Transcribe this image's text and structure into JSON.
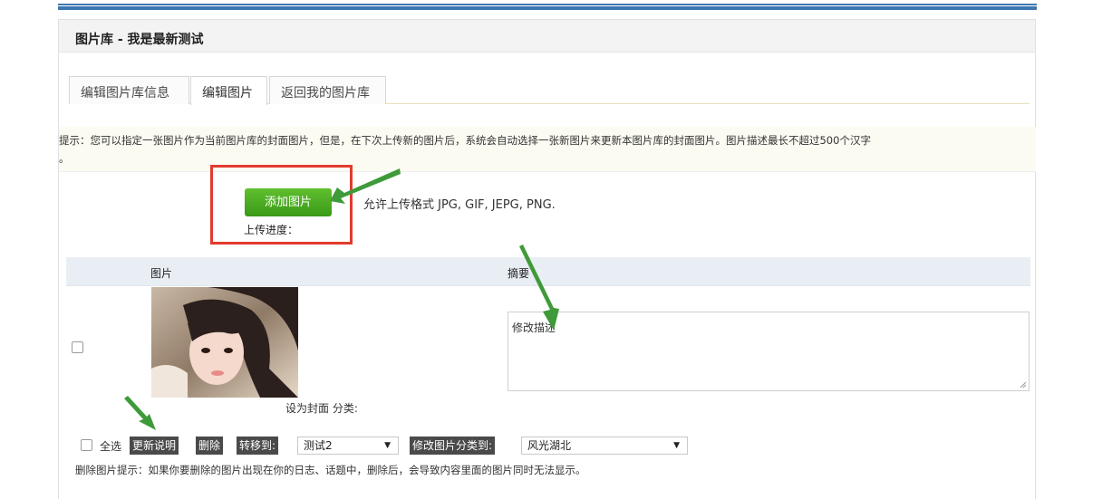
{
  "panel": {
    "title": "图片库 - 我是最新测试"
  },
  "tabs": [
    {
      "label": "编辑图片库信息"
    },
    {
      "label": "编辑图片"
    },
    {
      "label": "返回我的图片库"
    }
  ],
  "tip": {
    "line1": "提示：您可以指定一张图片作为当前图片库的封面图片，但是，在下次上传新的图片后，系统会自动选择一张新图片来更新本图片库的封面图片。图片描述最长不超过500个汉字",
    "line2": "。"
  },
  "upload": {
    "button_label": "添加图片",
    "formats": "允许上传格式 JPG, GIF, JEPG, PNG.",
    "progress_label": "上传进度："
  },
  "table": {
    "col_image": "图片",
    "col_summary": "摘要",
    "rows": [
      {
        "set_cover": "设为封面 分类:",
        "summary": "修改描述"
      }
    ]
  },
  "bulk": {
    "select_all": "全选",
    "update_desc": "更新说明",
    "delete": "删除",
    "move_to": "转移到:",
    "move_target": "测试2",
    "change_category": "修改图片分类到:",
    "category_value": "风光湖北",
    "dropdown_arrow": "▼"
  },
  "delete_tip": "删除图片提示：如果你要删除的图片出现在你的日志、话题中，删除后，会导致内容里面的图片同时无法显示。",
  "colors": {
    "accent_blue": "#3d78b1",
    "button_green": "#4aa71f",
    "highlight_red": "#e23b2e",
    "arrow_green": "#3f9a3a"
  }
}
